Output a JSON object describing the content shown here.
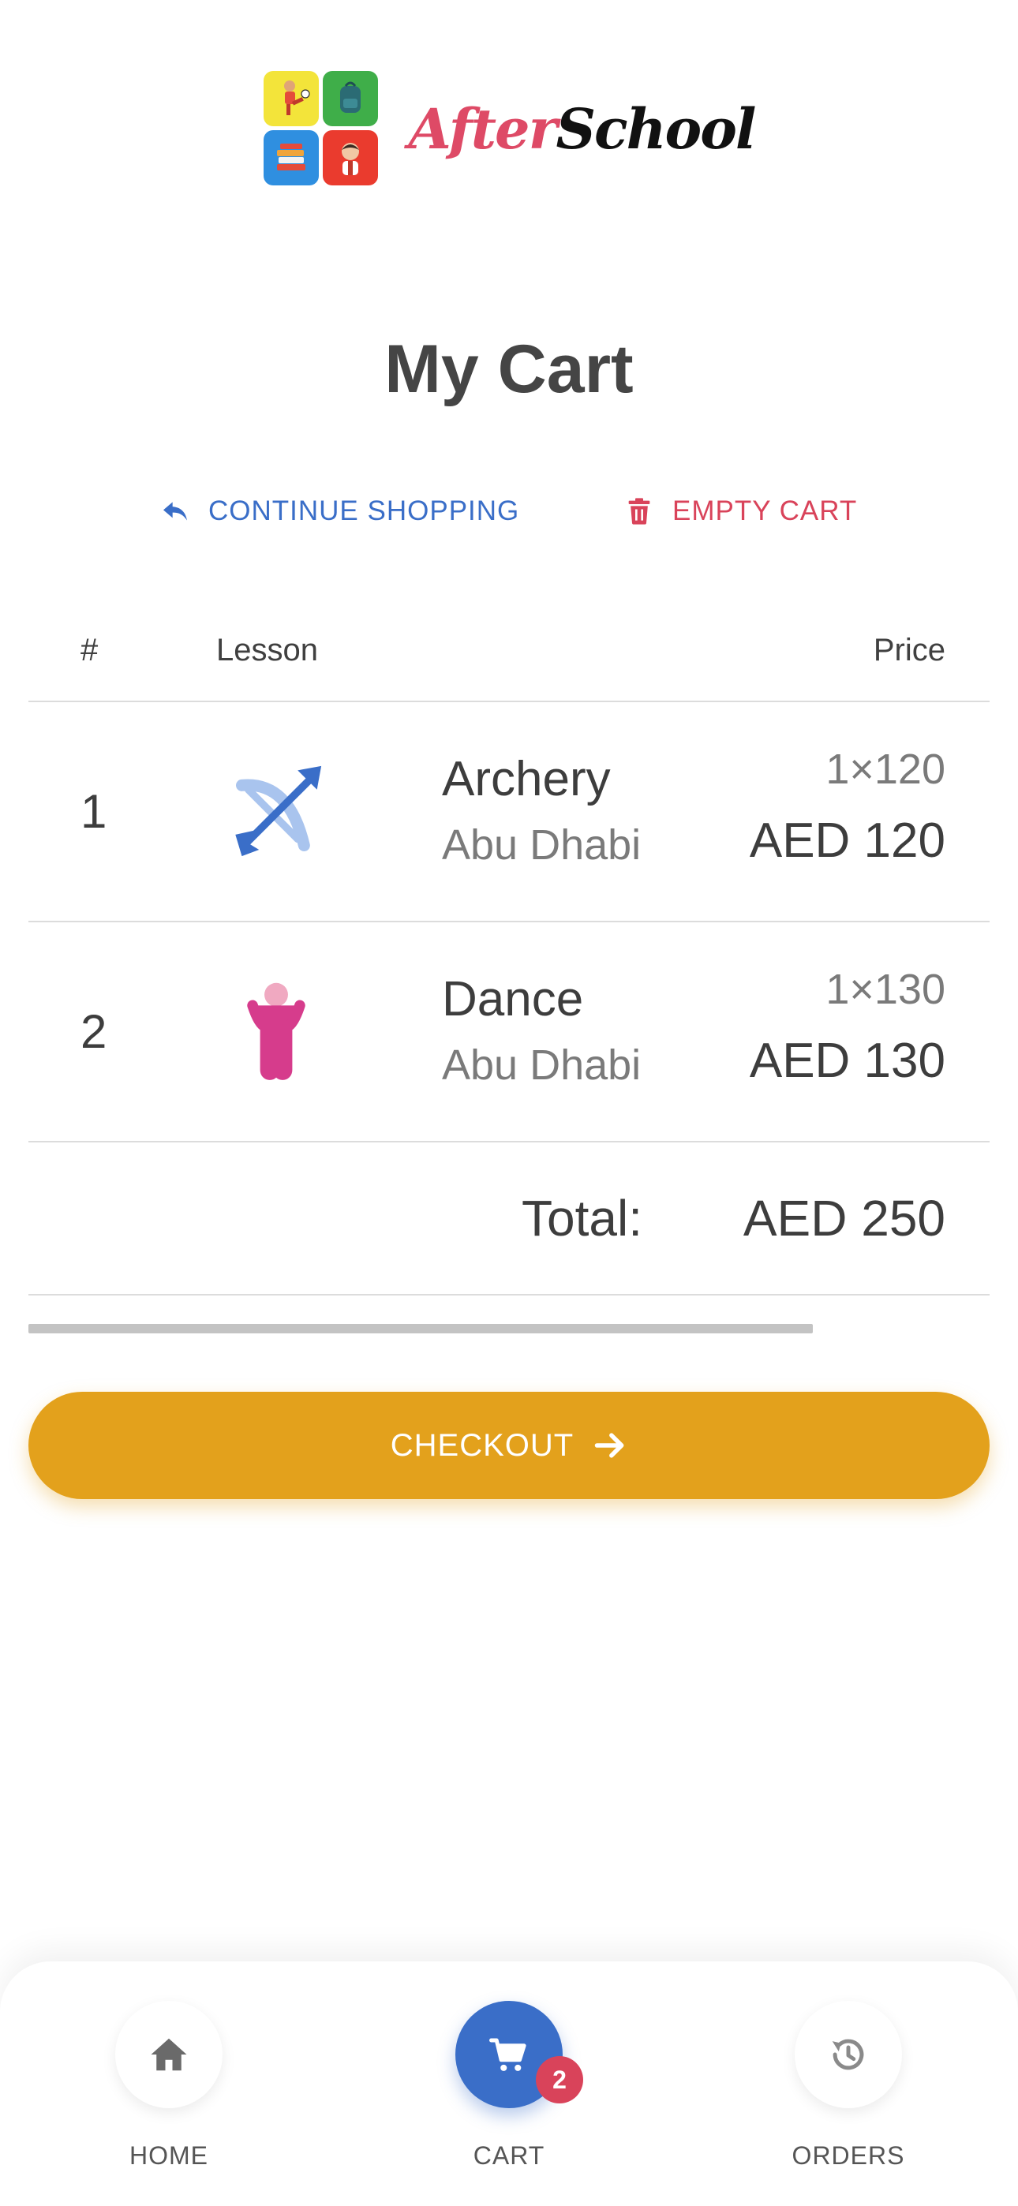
{
  "brand": {
    "name_part1": "After",
    "name_part2": "School"
  },
  "page": {
    "title": "My Cart"
  },
  "actions": {
    "continue_shopping": "CONTINUE SHOPPING",
    "empty_cart": "EMPTY CART"
  },
  "table": {
    "headers": {
      "number": "#",
      "lesson": "Lesson",
      "price": "Price"
    },
    "rows": [
      {
        "number": "1",
        "icon": "archery-icon",
        "name": "Archery",
        "location": "Abu Dhabi",
        "quantity": "1×120",
        "price": "AED 120"
      },
      {
        "number": "2",
        "icon": "dance-icon",
        "name": "Dance",
        "location": "Abu Dhabi",
        "quantity": "1×130",
        "price": "AED 130"
      }
    ],
    "total_label": "Total:",
    "total_value": "AED 250"
  },
  "checkout": {
    "label": "CHECKOUT"
  },
  "nav": {
    "items": [
      {
        "label": "HOME",
        "icon": "home-icon",
        "active": false
      },
      {
        "label": "CART",
        "icon": "cart-icon",
        "active": true,
        "badge": "2"
      },
      {
        "label": "ORDERS",
        "icon": "history-icon",
        "active": false
      }
    ]
  },
  "colors": {
    "primary_blue": "#3a6ec8",
    "danger_red": "#d9435a",
    "checkout_gold": "#e3a11c",
    "brand_pink": "#de4a66"
  }
}
